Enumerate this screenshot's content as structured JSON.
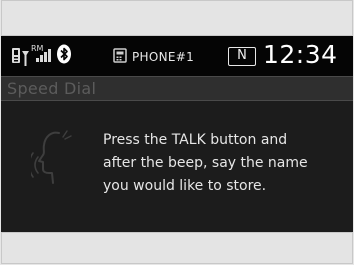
{
  "status_bar": {
    "icons": [
      "phone-signal-icon",
      "roam-indicator-icon",
      "signal-strength-icon",
      "bluetooth-icon"
    ],
    "roam_label": "RM",
    "phone_icon": "phone-icon",
    "phone_label": "PHONE#1",
    "gear": "N",
    "clock": "12:34"
  },
  "header": {
    "title": "Speed Dial"
  },
  "main": {
    "icon": "voice-speak-icon",
    "message_lines": [
      "Press the TALK button and",
      "after the beep, say the name",
      "you would like to store."
    ]
  },
  "colors": {
    "status_bar_bg": "#050505",
    "header_bg": "#2f2f2f",
    "header_text": "#5c5c5c",
    "content_bg": "#1c1c1c",
    "text": "#e6e6e6",
    "frame": "#e6e6e6"
  }
}
